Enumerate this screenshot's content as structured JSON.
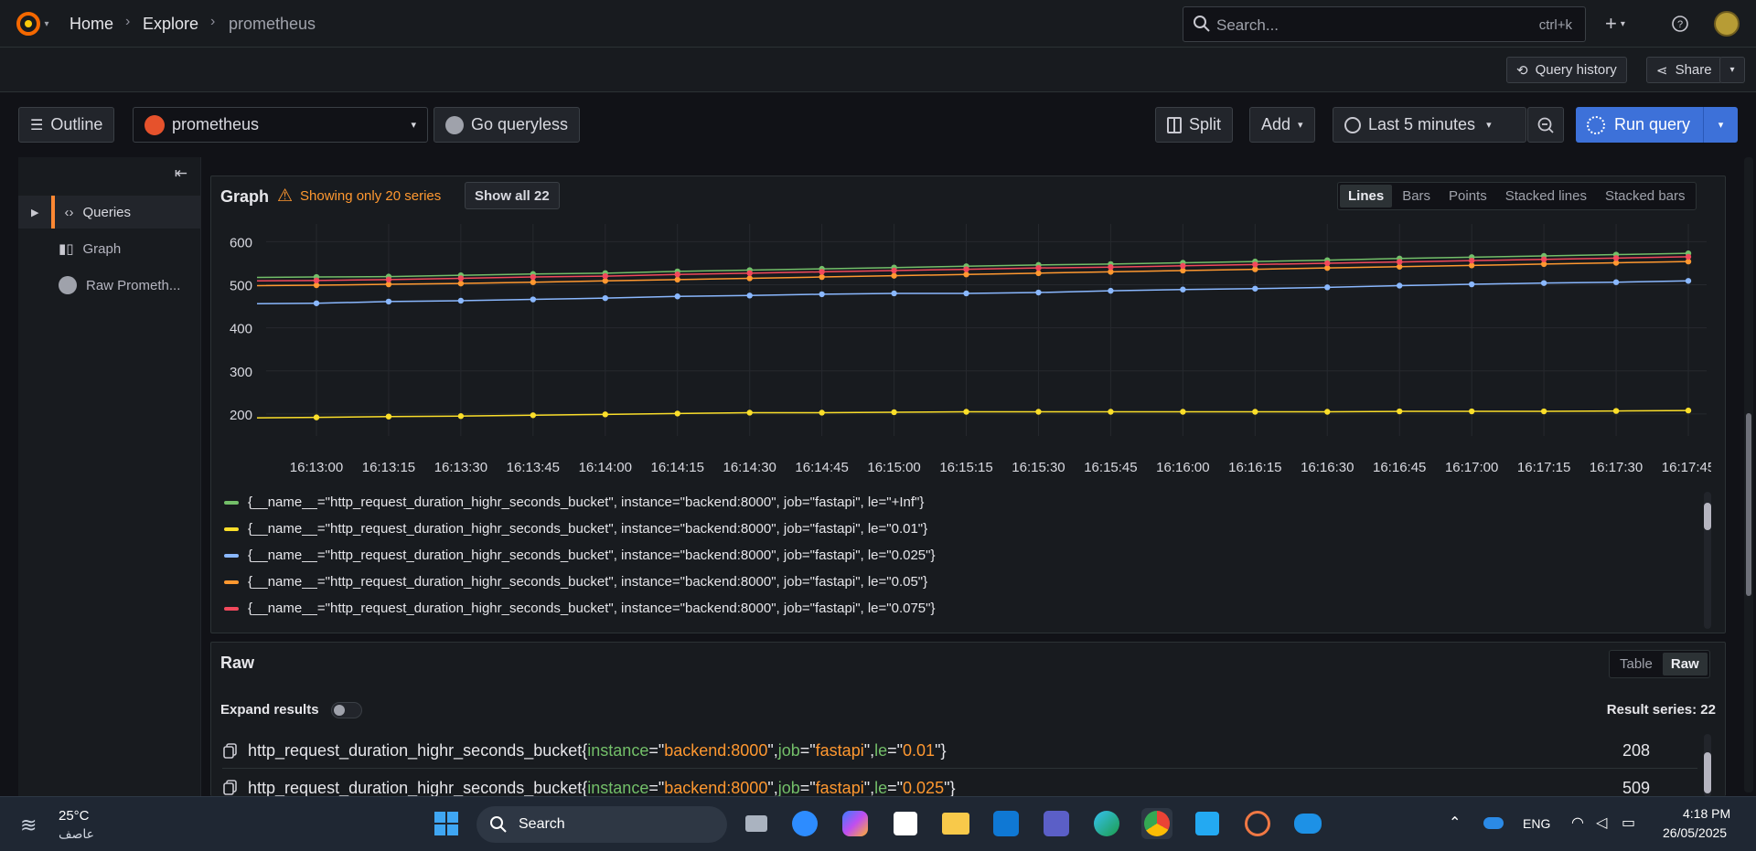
{
  "nav": {
    "breadcrumbs": [
      "Home",
      "Explore",
      "prometheus"
    ],
    "search_placeholder": "Search...",
    "search_shortcut": "ctrl+k",
    "query_history": "Query history",
    "share": "Share"
  },
  "toolbar": {
    "outline": "Outline",
    "datasource": "prometheus",
    "go_queryless": "Go queryless",
    "split": "Split",
    "add": "Add",
    "time_range": "Last 5 minutes",
    "run_query": "Run query"
  },
  "outline": {
    "items": [
      "Queries",
      "Graph",
      "Raw Prometh..."
    ]
  },
  "graph": {
    "title": "Graph",
    "warning": "Showing only 20 series",
    "show_all": "Show all 22",
    "modes": [
      "Lines",
      "Bars",
      "Points",
      "Stacked lines",
      "Stacked bars"
    ],
    "active_mode": "Lines"
  },
  "chart_data": {
    "type": "line",
    "x": [
      "16:13:00",
      "16:13:15",
      "16:13:30",
      "16:13:45",
      "16:14:00",
      "16:14:15",
      "16:14:30",
      "16:14:45",
      "16:15:00",
      "16:15:15",
      "16:15:30",
      "16:15:45",
      "16:16:00",
      "16:16:15",
      "16:16:30",
      "16:16:45",
      "16:17:00",
      "16:17:15",
      "16:17:30",
      "16:17:45"
    ],
    "ylim": [
      170,
      620
    ],
    "yticks": [
      200,
      300,
      400,
      500,
      600
    ],
    "grid": true,
    "legend_position": "bottom",
    "series": [
      {
        "name": "{__name__=\"http_request_duration_highr_seconds_bucket\", instance=\"backend:8000\", job=\"fastapi\", le=\"+Inf\"}",
        "color": "#73bf69",
        "values": [
          518,
          519,
          522,
          525,
          527,
          531,
          534,
          537,
          540,
          543,
          546,
          548,
          551,
          554,
          557,
          561,
          564,
          567,
          570,
          573
        ]
      },
      {
        "name": "{__name__=\"http_request_duration_highr_seconds_bucket\", instance=\"backend:8000\", job=\"fastapi\", le=\"0.01\"}",
        "color": "#fade2a",
        "values": [
          192,
          194,
          195,
          197,
          199,
          201,
          203,
          203,
          204,
          205,
          205,
          205,
          205,
          205,
          205,
          206,
          206,
          206,
          207,
          208
        ]
      },
      {
        "name": "{__name__=\"http_request_duration_highr_seconds_bucket\", instance=\"backend:8000\", job=\"fastapi\", le=\"0.025\"}",
        "color": "#8ab8ff",
        "values": [
          457,
          461,
          463,
          466,
          469,
          473,
          475,
          478,
          480,
          480,
          482,
          486,
          489,
          491,
          494,
          498,
          501,
          504,
          506,
          509
        ]
      },
      {
        "name": "{__name__=\"http_request_duration_highr_seconds_bucket\", instance=\"backend:8000\", job=\"fastapi\", le=\"0.05\"}",
        "color": "#ff9830",
        "values": [
          499,
          501,
          503,
          506,
          509,
          512,
          515,
          518,
          521,
          524,
          527,
          530,
          533,
          536,
          539,
          542,
          545,
          548,
          551,
          554
        ]
      },
      {
        "name": "{__name__=\"http_request_duration_highr_seconds_bucket\", instance=\"backend:8000\", job=\"fastapi\", le=\"0.075\"}",
        "color": "#f2495c",
        "values": [
          510,
          512,
          515,
          518,
          520,
          524,
          527,
          530,
          533,
          536,
          539,
          541,
          544,
          547,
          550,
          553,
          556,
          559,
          562,
          565
        ]
      }
    ]
  },
  "raw": {
    "title": "Raw",
    "modes": [
      "Table",
      "Raw"
    ],
    "active_mode": "Raw",
    "expand_label": "Expand results",
    "result_series": "Result series: 22",
    "rows": [
      {
        "metric": "http_request_duration_highr_seconds_bucket",
        "instance": "backend:8000",
        "job": "fastapi",
        "le": "0.01",
        "value": "208"
      },
      {
        "metric": "http_request_duration_highr_seconds_bucket",
        "instance": "backend:8000",
        "job": "fastapi",
        "le": "0.025",
        "value": "509"
      }
    ]
  },
  "taskbar": {
    "weather_temp": "25°C",
    "weather_desc": "عاصف",
    "search": "Search",
    "lang": "ENG",
    "time": "4:18 PM",
    "date": "26/05/2025"
  }
}
